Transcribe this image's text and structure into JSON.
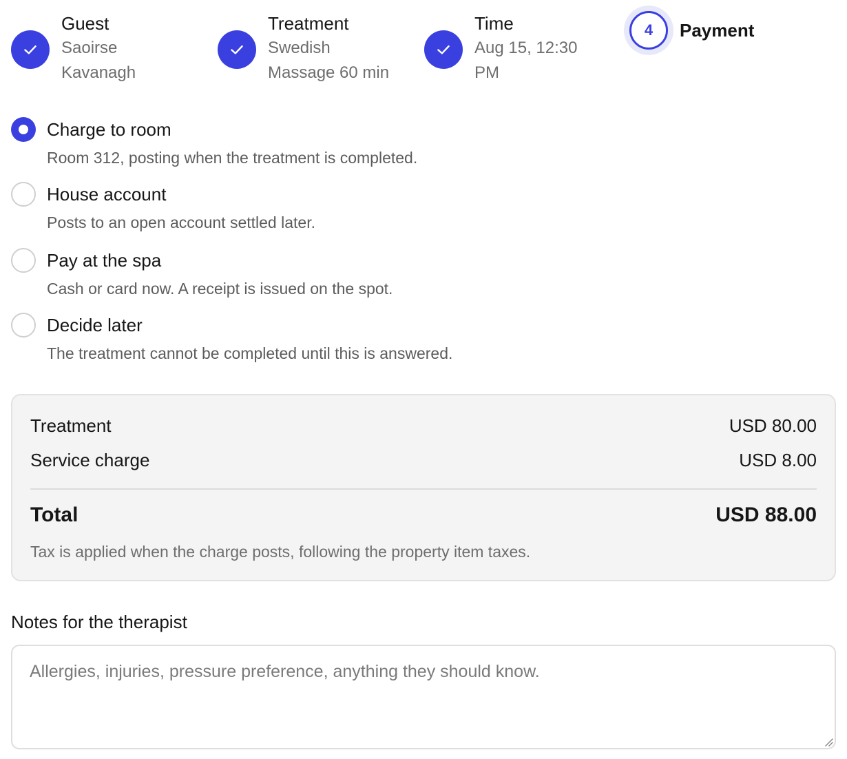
{
  "stepper": {
    "steps": [
      {
        "title": "Guest",
        "sub1": "Saoirse",
        "sub2": "Kavanagh",
        "status": "done"
      },
      {
        "title": "Treatment",
        "sub1": "Swedish",
        "sub2": "Massage 60 min",
        "status": "done"
      },
      {
        "title": "Time",
        "sub1": "Aug 15, 12:30",
        "sub2": "PM",
        "status": "done"
      }
    ],
    "current": {
      "number": "4",
      "title": "Payment"
    }
  },
  "payment_options": [
    {
      "label": "Charge to room",
      "desc": "Room 312, posting when the treatment is completed.",
      "selected": true
    },
    {
      "label": "House account",
      "desc": "Posts to an open account settled later.",
      "selected": false
    },
    {
      "label": "Pay at the spa",
      "desc": "Cash or card now. A receipt is issued on the spot.",
      "selected": false
    },
    {
      "label": "Decide later",
      "desc": "The treatment cannot be completed until this is answered.",
      "selected": false
    }
  ],
  "summary": {
    "treatment_label": "Treatment",
    "treatment_value": "USD 80.00",
    "service_label": "Service charge",
    "service_value": "USD 8.00",
    "total_label": "Total",
    "total_value": "USD 88.00",
    "tax_note": "Tax is applied when the charge posts, following the property item taxes."
  },
  "notes": {
    "label": "Notes for the therapist",
    "placeholder": "Allergies, injuries, pressure preference, anything they should know.",
    "value": ""
  },
  "colors": {
    "accent": "#3a3fe0",
    "accent_soft": "#e7e9fb",
    "muted_text": "#6e6e6e",
    "summary_bg": "#f4f4f4"
  }
}
